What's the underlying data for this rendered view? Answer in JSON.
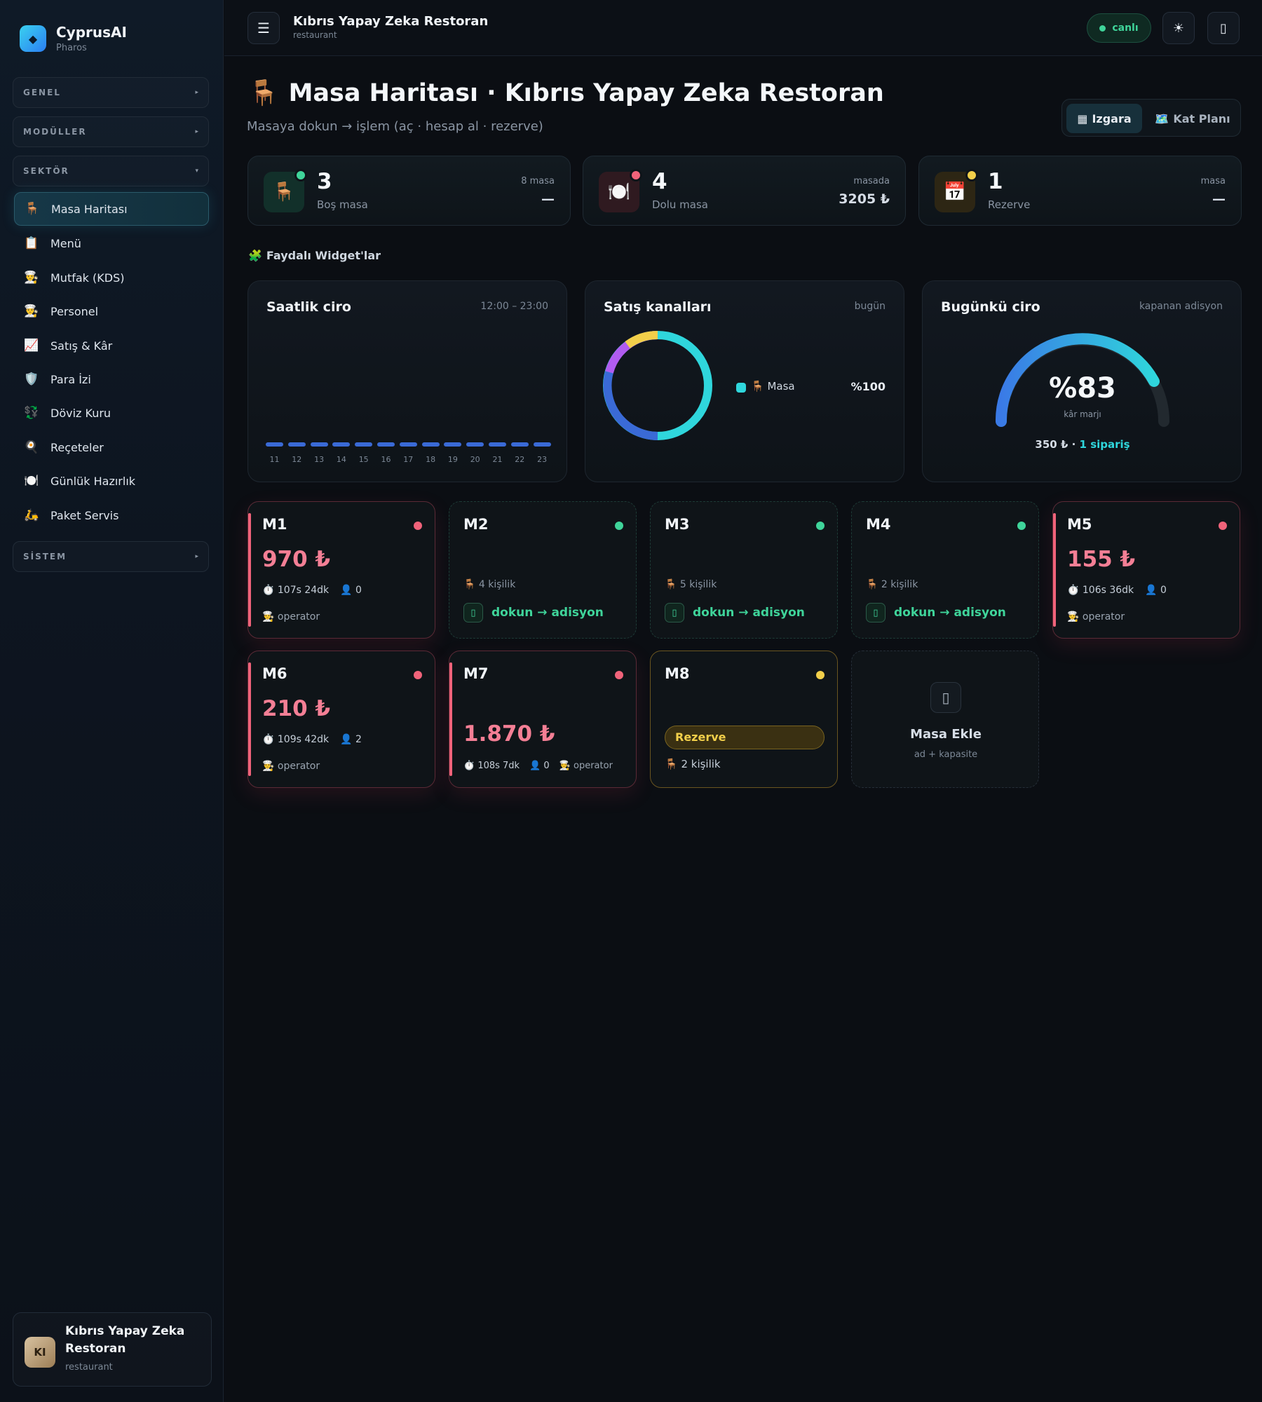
{
  "brand": {
    "name": "CyprusAI",
    "sub": "Pharos",
    "logo_icon": "◆"
  },
  "sidebar": {
    "sections": [
      {
        "label": "GENEL",
        "arrow": "▸"
      },
      {
        "label": "MODÜLLER",
        "arrow": "▸"
      },
      {
        "label": "SEKTÖR",
        "arrow": "▾"
      },
      {
        "label": "SİSTEM",
        "arrow": "▸"
      }
    ],
    "items": [
      {
        "icon": "🪑",
        "label": "Masa Haritası",
        "active": true
      },
      {
        "icon": "📋",
        "label": "Menü"
      },
      {
        "icon": "👨‍🍳",
        "label": "Mutfak (KDS)"
      },
      {
        "icon": "👨‍🍳",
        "label": "Personel"
      },
      {
        "icon": "📈",
        "label": "Satış & Kâr"
      },
      {
        "icon": "🛡️",
        "label": "Para İzi"
      },
      {
        "icon": "💱",
        "label": "Döviz Kuru"
      },
      {
        "icon": "🍳",
        "label": "Reçeteler"
      },
      {
        "icon": "🍽️",
        "label": "Günlük Hazırlık"
      },
      {
        "icon": "🛵",
        "label": "Paket Servis"
      }
    ],
    "workspace": {
      "initials": "KI",
      "name": "Kıbrıs Yapay Zeka Restoran",
      "type": "restaurant"
    }
  },
  "topbar": {
    "menu_icon": "☰",
    "title": "Kıbrıs Yapay Zeka Restoran",
    "sub": "restaurant",
    "live": "canlı",
    "theme_icon": "☀",
    "extra_icon": "▯"
  },
  "page": {
    "icon": "🪑",
    "title": "Masa Haritası · Kıbrıs Yapay Zeka Restoran",
    "sub": "Masaya dokun → işlem (aç · hesap al · rezerve)",
    "view_grid": "Izgara",
    "view_grid_icon": "▦",
    "view_plan": "Kat Planı",
    "view_plan_icon": "🗺️"
  },
  "stats": [
    {
      "icon": "🪑",
      "value": "3",
      "label": "Boş masa",
      "right_top": "8 masa",
      "right_val": "—",
      "dot": "#3fd49a",
      "bg": "#12302a"
    },
    {
      "icon": "🍽️",
      "value": "4",
      "label": "Dolu masa",
      "right_top": "masada",
      "right_val": "3205 ₺",
      "dot": "#f0637a",
      "bg": "#2f1a20"
    },
    {
      "icon": "📅",
      "value": "1",
      "label": "Rezerve",
      "right_top": "masa",
      "right_val": "—",
      "dot": "#f2cf4a",
      "bg": "#2d2614"
    }
  ],
  "widgets_heading": {
    "icon": "🧩",
    "label": "Faydalı Widget'lar"
  },
  "widgets": {
    "hourly": {
      "title": "Saatlik ciro",
      "note": "12:00 – 23:00"
    },
    "channels": {
      "title": "Satış kanalları",
      "note": "bugün",
      "legend_icon": "🪑",
      "legend_label": "Masa",
      "legend_pct": "%100"
    },
    "revenue": {
      "title": "Bugünkü ciro",
      "note": "kapanan adisyon",
      "value": "%83",
      "label": "kâr marjı",
      "amount": "350 ₺ · ",
      "orders": "1 sipariş"
    }
  },
  "chart_data": {
    "type": "bar",
    "title": "Saatlik ciro",
    "categories": [
      "11",
      "12",
      "13",
      "14",
      "15",
      "16",
      "17",
      "18",
      "19",
      "20",
      "21",
      "22",
      "23"
    ],
    "values": [
      0,
      0,
      0,
      0,
      0,
      0,
      0,
      0,
      0,
      0,
      0,
      0,
      0
    ]
  },
  "tables": [
    {
      "name": "M1",
      "state": "busy",
      "amount": "970 ₺",
      "time": "⏱️ 107s 24dk",
      "guests": "👤 0",
      "waiter": "👨‍🍳 operator"
    },
    {
      "name": "M2",
      "state": "free",
      "seats": "🪑 4 kişilik",
      "action": "dokun → adisyon",
      "action_icon": "▯"
    },
    {
      "name": "M3",
      "state": "free",
      "seats": "🪑 5 kişilik",
      "action": "dokun → adisyon",
      "action_icon": "▯"
    },
    {
      "name": "M4",
      "state": "free",
      "seats": "🪑 2 kişilik",
      "action": "dokun → adisyon",
      "action_icon": "▯"
    },
    {
      "name": "M5",
      "state": "busy",
      "amount": "155 ₺",
      "time": "⏱️ 106s 36dk",
      "guests": "👤 0",
      "waiter": "👨‍🍳 operator"
    },
    {
      "name": "M6",
      "state": "busy",
      "amount": "210 ₺",
      "time": "⏱️ 109s 42dk",
      "guests": "👤 2",
      "waiter": "👨‍🍳 operator"
    },
    {
      "name": "M7",
      "state": "busy",
      "amount": "1.870 ₺",
      "time": "⏱️ 108s 7dk",
      "guests": "👤 0",
      "waiter": "👨‍🍳 operator"
    },
    {
      "name": "M8",
      "state": "reserved",
      "badge": "Rezerve",
      "seats": "🪑 2 kişilik"
    }
  ],
  "add_table": {
    "icon": "▯",
    "title": "Masa Ekle",
    "sub": "ad + kapasite"
  },
  "colors": {
    "busy": "#f0637a",
    "free": "#3fd49a",
    "reserved": "#f2cf4a",
    "accent": "#2fd6dc"
  }
}
